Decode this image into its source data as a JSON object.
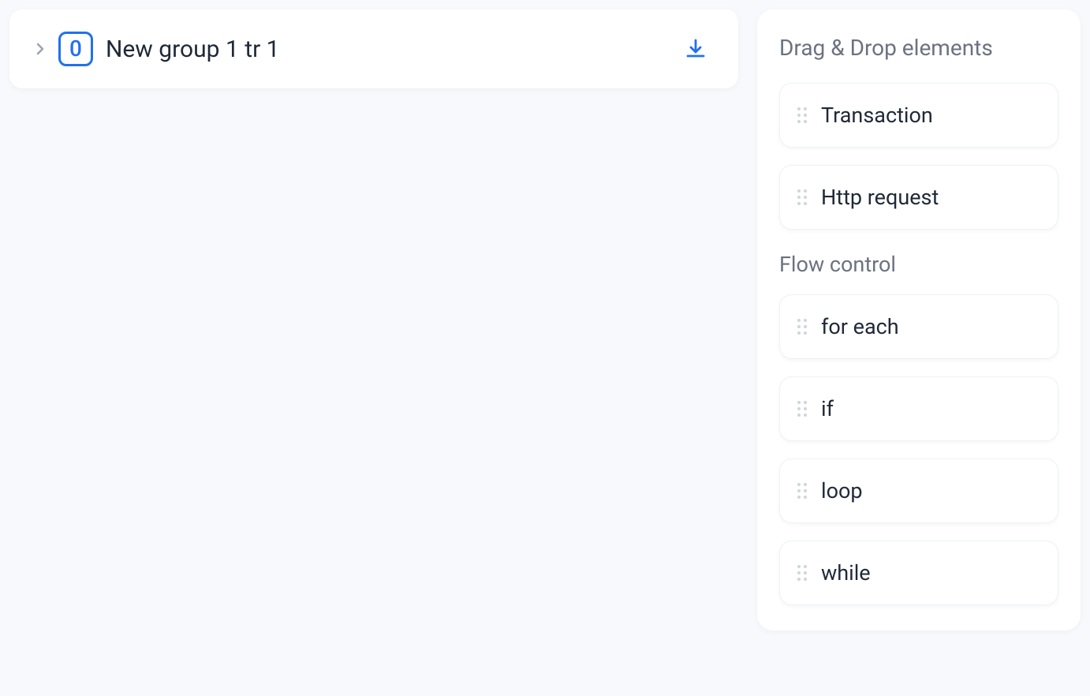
{
  "group": {
    "index": "0",
    "title": "New group 1 tr 1"
  },
  "sidebar": {
    "title": "Drag & Drop elements",
    "basic_elements": [
      {
        "label": "Transaction"
      },
      {
        "label": "Http request"
      }
    ],
    "flow_section_title": "Flow control",
    "flow_elements": [
      {
        "label": "for each"
      },
      {
        "label": "if"
      },
      {
        "label": "loop"
      },
      {
        "label": "while"
      }
    ]
  }
}
